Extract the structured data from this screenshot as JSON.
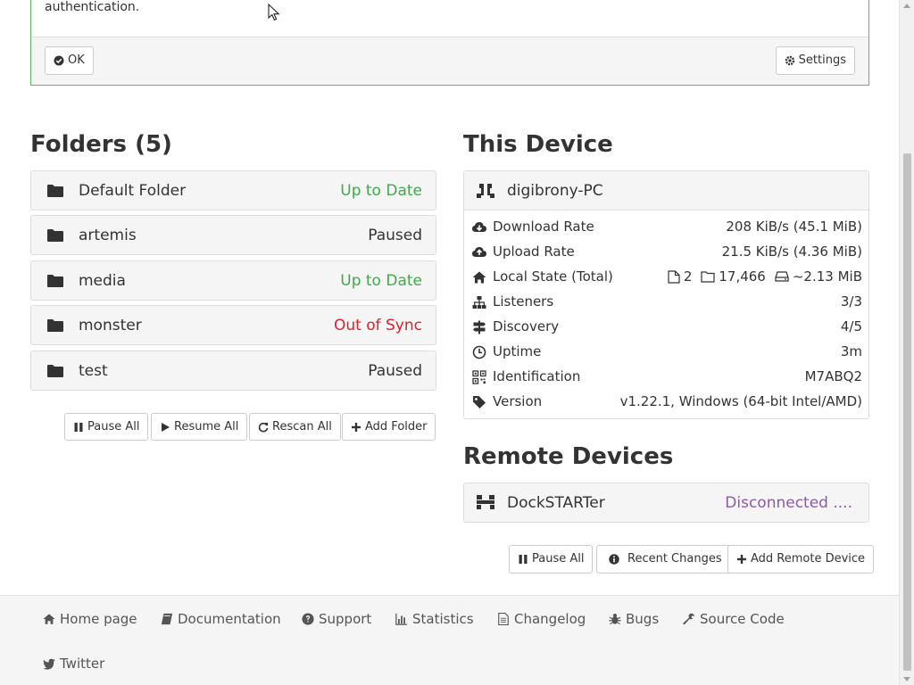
{
  "notice": {
    "text": "authentication.",
    "ok_label": "OK",
    "settings_label": "Settings"
  },
  "folders": {
    "title": "Folders (5)",
    "items": [
      {
        "name": "Default Folder",
        "status": "Up to Date",
        "status_color": "#3fa94c"
      },
      {
        "name": "artemis",
        "status": "Paused",
        "status_color": "#333333"
      },
      {
        "name": "media",
        "status": "Up to Date",
        "status_color": "#3fa94c"
      },
      {
        "name": "monster",
        "status": "Out of Sync",
        "status_color": "#d9232d"
      },
      {
        "name": "test",
        "status": "Paused",
        "status_color": "#333333"
      }
    ],
    "buttons": {
      "pause_all": "Pause All",
      "resume_all": "Resume All",
      "rescan_all": "Rescan All",
      "add_folder": "Add Folder"
    }
  },
  "this_device": {
    "title": "This Device",
    "name": "digibrony-PC",
    "rows": {
      "download": {
        "label": "Download Rate",
        "value": "208 KiB/s (45.1 MiB)",
        "icon": "cloud-download-icon"
      },
      "upload": {
        "label": "Upload Rate",
        "value": "21.5 KiB/s (4.36 MiB)",
        "icon": "cloud-upload-icon"
      },
      "local_state": {
        "label": "Local State (Total)",
        "files": "2",
        "folders": "17,466",
        "size": "~2.13 MiB",
        "icon": "home-icon"
      },
      "listeners": {
        "label": "Listeners",
        "value": "3/3",
        "icon": "sitemap-icon"
      },
      "discovery": {
        "label": "Discovery",
        "value": "4/5",
        "icon": "signpost-icon"
      },
      "uptime": {
        "label": "Uptime",
        "value": "3m",
        "icon": "clock-icon"
      },
      "identification": {
        "label": "Identification",
        "value": "M7ABQ2",
        "icon": "qrcode-icon"
      },
      "version": {
        "label": "Version",
        "value": "v1.22.1, Windows (64-bit Intel/AMD)",
        "icon": "tag-icon"
      }
    }
  },
  "remote_devices": {
    "title": "Remote Devices",
    "items": [
      {
        "name": "DockSTARTer",
        "status": "Disconnected ...."
      }
    ],
    "buttons": {
      "pause_all": "Pause All",
      "recent_changes": "Recent Changes",
      "add_remote": "Add Remote Device"
    }
  },
  "footer": {
    "links": [
      "Home page",
      "Documentation",
      "Support",
      "Statistics",
      "Changelog",
      "Bugs",
      "Source Code",
      "Twitter"
    ]
  },
  "colors": {
    "accent_green": "#5cb85c",
    "status_green": "#3fa94c",
    "status_red": "#d9232d",
    "status_purple": "#8e5aa6",
    "link_blue": "#3d8fc8"
  }
}
